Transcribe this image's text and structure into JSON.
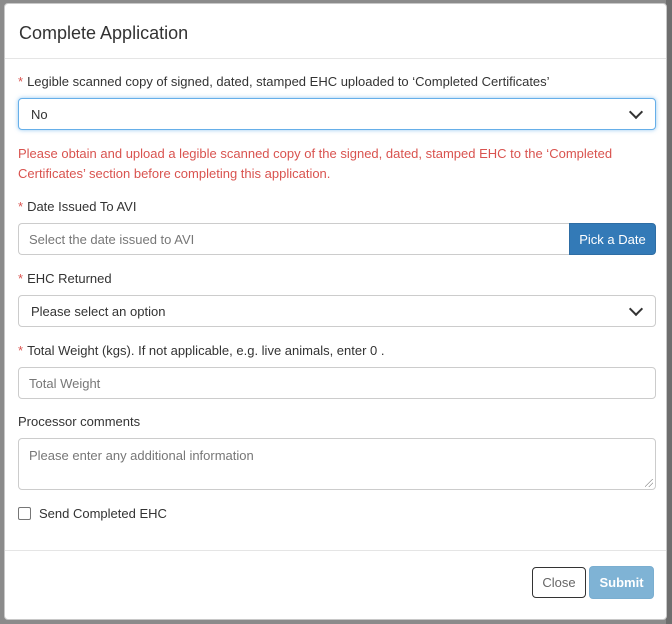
{
  "modal": {
    "title": "Complete Application"
  },
  "ehc_uploaded": {
    "required_mark": "*",
    "label": "Legible scanned copy of signed, dated, stamped EHC uploaded to ‘Completed Certificates’",
    "selected": "No"
  },
  "error": {
    "line1": "Please obtain and upload a legible scanned copy of the signed, dated, stamped EHC to the ‘Completed",
    "line2": "Certificates’ section before completing this application."
  },
  "date_issued": {
    "required_mark": "*",
    "label": "Date Issued To AVI",
    "placeholder": "Select the date issued to AVI",
    "button_label": "Pick a Date"
  },
  "ehc_returned": {
    "required_mark": "*",
    "label": "EHC Returned",
    "selected": "Please select an option"
  },
  "total_weight": {
    "required_mark": "*",
    "label": "Total Weight (kgs). If not applicable, e.g. live animals, enter 0 .",
    "placeholder": "Total Weight"
  },
  "comments": {
    "label": "Processor comments",
    "placeholder": "Please enter any additional information"
  },
  "send_completed": {
    "label": "Send Completed EHC",
    "checked": false
  },
  "footer": {
    "close_label": "Close",
    "submit_label": "Submit"
  },
  "colors": {
    "primary": "#337ab7",
    "error": "#d9534f",
    "submit_disabled": "#7fb3d5"
  }
}
